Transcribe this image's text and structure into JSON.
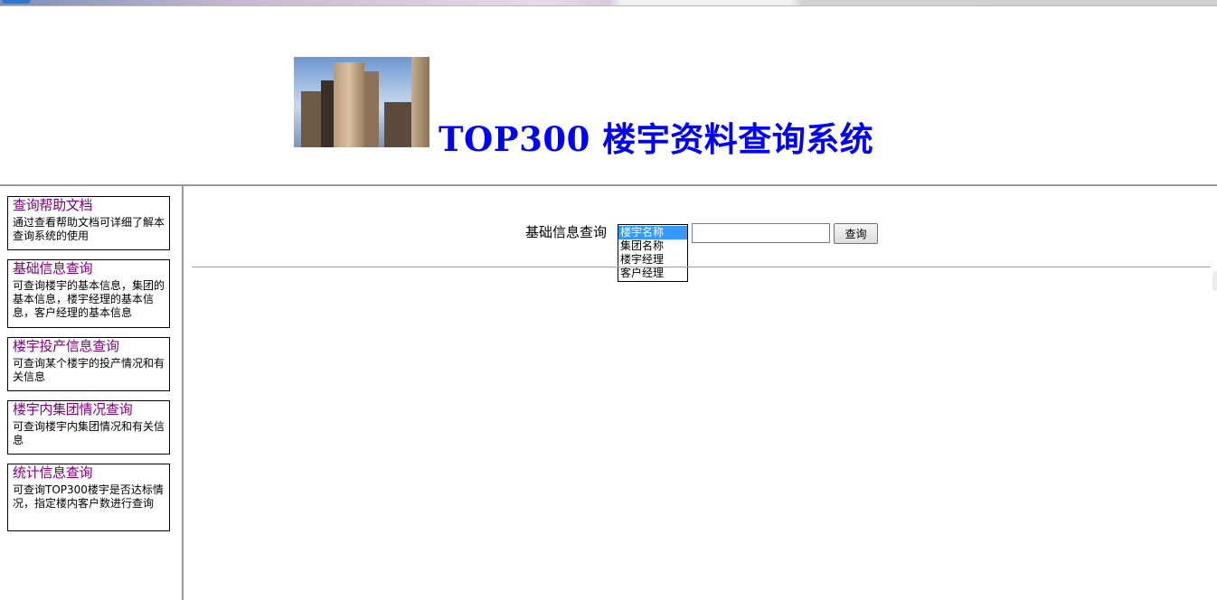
{
  "header": {
    "title": "TOP300 楼宇资料查询系统",
    "image_icon": "building-photo"
  },
  "sidebar": {
    "items": [
      {
        "title": "查询帮助文档",
        "description": "通过查看帮助文档可详细了解本查询系统的使用"
      },
      {
        "title": "基础信息查询",
        "description": "可查询楼宇的基本信息，集团的基本信息，楼宇经理的基本信息，客户经理的基本信息"
      },
      {
        "title": "楼宇投产信息查询",
        "description": "可查询某个楼宇的投产情况和有关信息"
      },
      {
        "title": "楼宇内集团情况查询",
        "description": "可查询楼宇内集团情况和有关信息"
      },
      {
        "title": "统计信息查询",
        "description": "可查询TOP300楼宇是否达标情况，指定楼内客户数进行查询"
      }
    ]
  },
  "search": {
    "label": "基础信息查询",
    "options": [
      "楼宇名称",
      "集团名称",
      "楼宇经理",
      "客户经理"
    ],
    "selected": "楼宇名称",
    "value": "",
    "button_label": "查询"
  },
  "colors": {
    "title": "#0000ff",
    "link_visited": "#800080",
    "selection": "#3399ff"
  }
}
